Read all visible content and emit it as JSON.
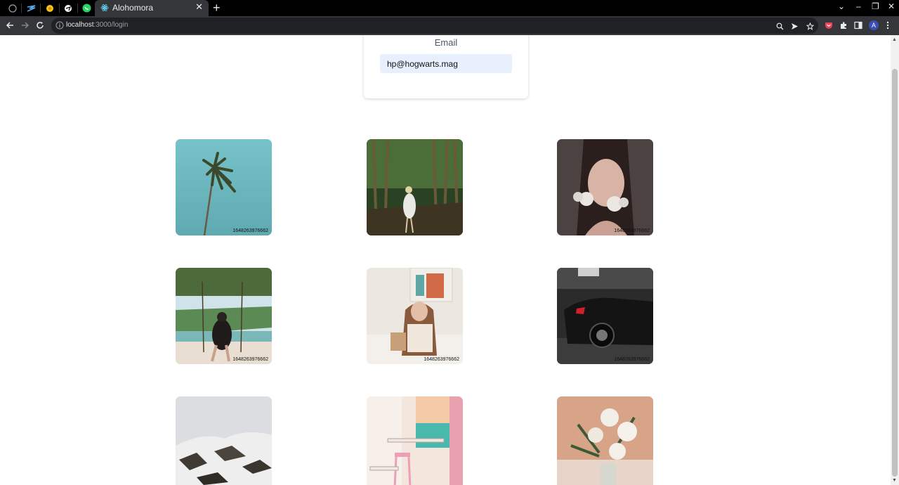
{
  "browser": {
    "tab_title": "Alohomora",
    "url_host": "localhost",
    "url_path": ":3000/login",
    "profile_initial": "A"
  },
  "login": {
    "email_label": "Email",
    "email_value": "hp@hogwarts.mag"
  },
  "gallery": {
    "photos": [
      {
        "subject": "palm tree against teal sky",
        "stamp": "1648263976662"
      },
      {
        "subject": "woman walking in forest",
        "stamp": ""
      },
      {
        "subject": "woman with flowers",
        "stamp": "1648263976662"
      },
      {
        "subject": "woman on swing by beach",
        "stamp": "1648263976662"
      },
      {
        "subject": "girl with toy",
        "stamp": "1648263976662"
      },
      {
        "subject": "black car in garage",
        "stamp": "1648263976662"
      },
      {
        "subject": "snowy mountains",
        "stamp": ""
      },
      {
        "subject": "pink chairs classroom",
        "stamp": ""
      },
      {
        "subject": "white roses bouquet",
        "stamp": ""
      }
    ]
  },
  "colors": {
    "input_bg": "#e8f0fe",
    "chrome_dark": "#35363a"
  }
}
